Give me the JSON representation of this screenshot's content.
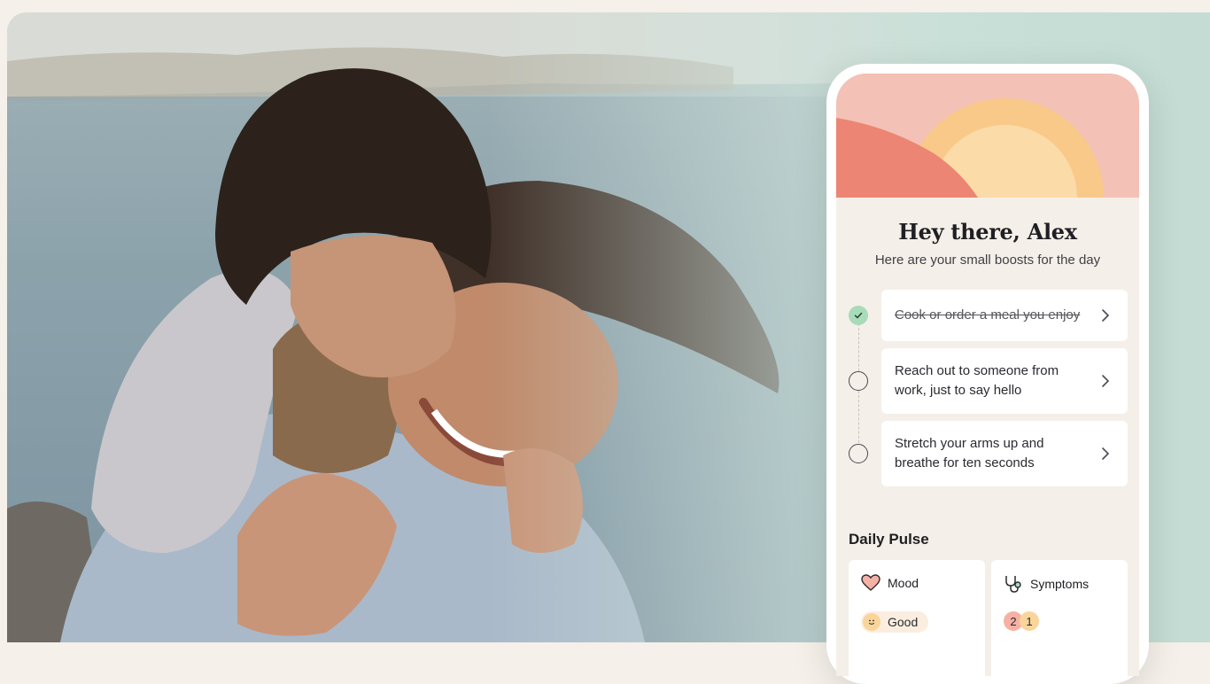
{
  "hero": {
    "image": "mother-and-daughter-hug-photo"
  },
  "phone": {
    "greeting": "Hey there, Alex",
    "subtitle": "Here are your small boosts for the day",
    "tasks": [
      {
        "label": "Cook or order a meal you enjoy",
        "completed": true
      },
      {
        "label": "Reach out to someone from work, just to say hello",
        "completed": false
      },
      {
        "label": "Stretch your arms up and breathe for ten seconds",
        "completed": false
      }
    ],
    "daily_pulse": {
      "title": "Daily Pulse",
      "mood": {
        "label": "Mood",
        "value": "Good",
        "icon": "heart-icon"
      },
      "symptoms": {
        "label": "Symptoms",
        "icon": "stethoscope-icon",
        "counts": [
          "2",
          "1"
        ]
      }
    }
  },
  "colors": {
    "banner_pink": "#f3c1b6",
    "hill_coral": "#ec8573",
    "sun_outer": "#f9c98a",
    "sun_inner": "#fbdba8",
    "done_green": "#a8dbb9",
    "badge_red": "#f6b1a4",
    "badge_yellow": "#f9d59b"
  }
}
